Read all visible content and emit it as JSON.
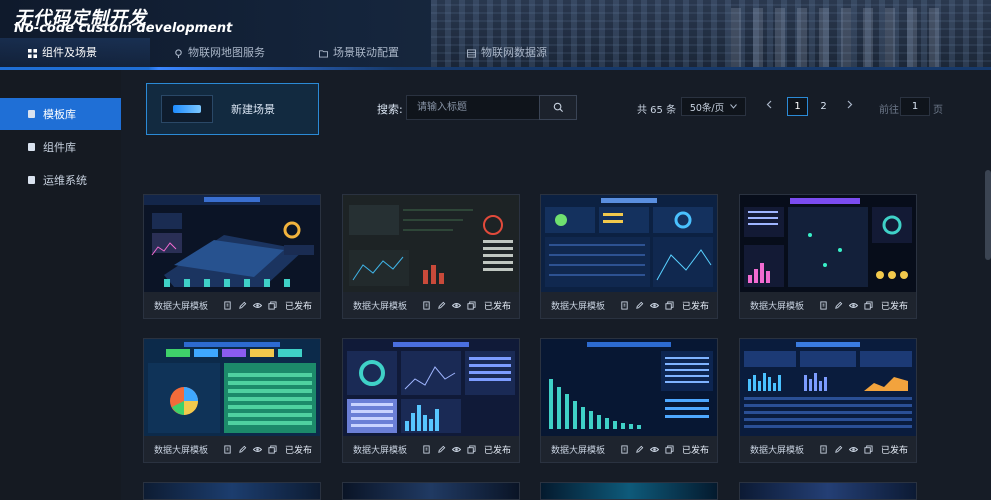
{
  "brand": {
    "title": "无代码定制开发",
    "subtitle": "No-code custom development"
  },
  "topnav": [
    {
      "label": "组件及场景",
      "icon": "grid-icon",
      "active": true
    },
    {
      "label": "物联网地图服务",
      "icon": "map-pin-icon",
      "active": false
    },
    {
      "label": "场景联动配置",
      "icon": "folder-icon",
      "active": false
    },
    {
      "label": "物联网数据源",
      "icon": "database-icon",
      "active": false
    }
  ],
  "sidebar": [
    {
      "label": "模板库",
      "active": true
    },
    {
      "label": "组件库",
      "active": false
    },
    {
      "label": "运维系统",
      "active": false
    }
  ],
  "toolbar": {
    "new_scene": "新建场景",
    "search_label": "搜索:",
    "search_placeholder": "请输入标题"
  },
  "pagination": {
    "total": "共 65 条",
    "page_size": "50条/页",
    "pages": [
      "1",
      "2"
    ],
    "current": "1",
    "goto_label": "前往",
    "goto_value": "1",
    "goto_suffix": "页"
  },
  "cards": [
    {
      "name": "数据大屏模板",
      "status": "已发布",
      "theme": "city"
    },
    {
      "name": "数据大屏模板",
      "status": "已发布",
      "theme": "dark-map"
    },
    {
      "name": "数据大屏模板",
      "status": "已发布",
      "theme": "blue-grid"
    },
    {
      "name": "数据大屏模板",
      "status": "已发布",
      "theme": "neon"
    },
    {
      "name": "数据大屏模板",
      "status": "已发布",
      "theme": "pie"
    },
    {
      "name": "数据大屏模板",
      "status": "已发布",
      "theme": "donut"
    },
    {
      "name": "数据大屏模板",
      "status": "已发布",
      "theme": "bars"
    },
    {
      "name": "数据大屏模板",
      "status": "已发布",
      "theme": "stats"
    }
  ],
  "colors": {
    "accent": "#1f6fd6",
    "border_active": "#2b8ad6",
    "bg": "#161c26",
    "card": "#1e242e"
  }
}
